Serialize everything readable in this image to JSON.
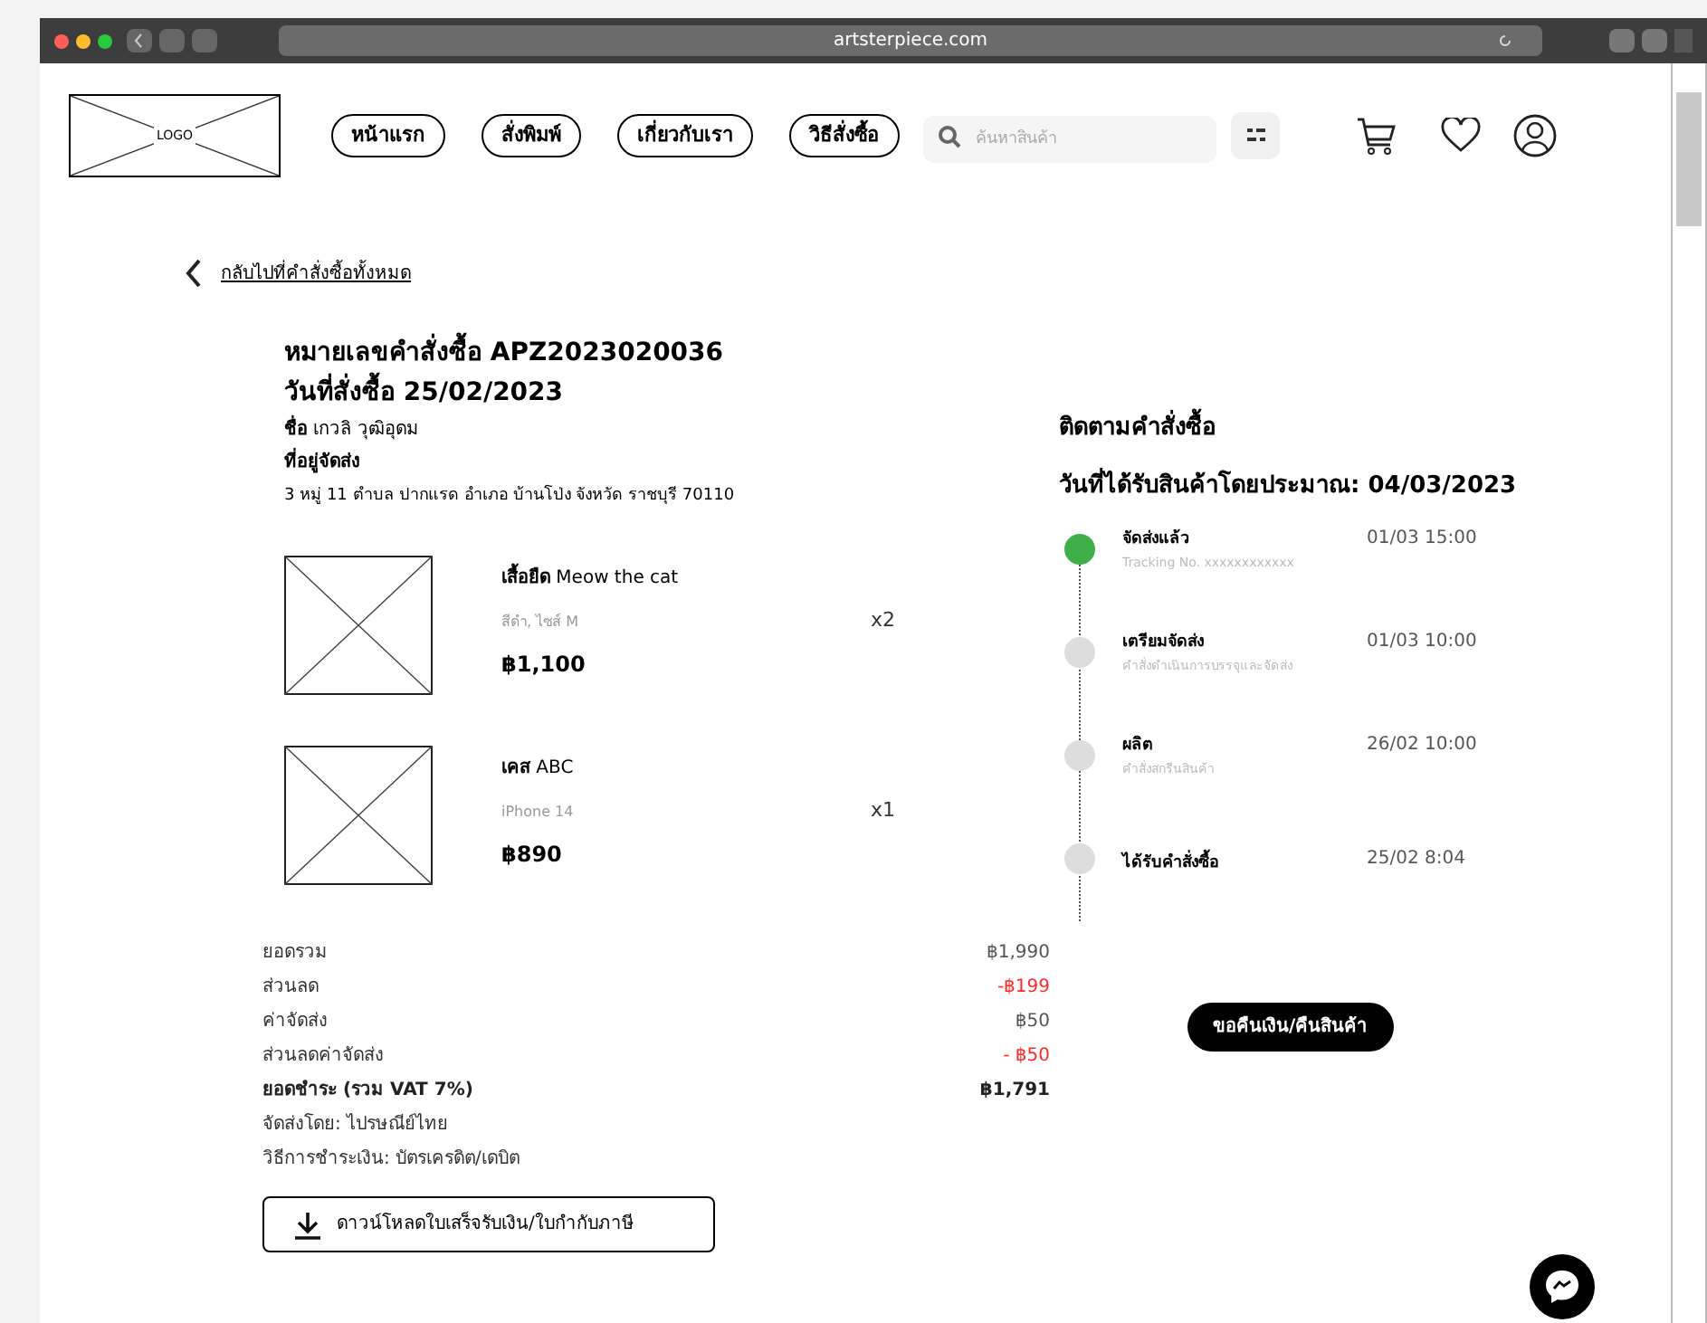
{
  "browser": {
    "url": "artsterpiece.com"
  },
  "nav": {
    "logo": "LOGO",
    "links": [
      "หน้าแรก",
      "สั่งพิมพ์",
      "เกี่ยวกับเรา",
      "วิธีสั่งซื้อ"
    ],
    "search": {
      "placeholder": "ค้นหาสินค้า"
    }
  },
  "back_link": "กลับไปที่คำสั่งซื้อทั้งหมด",
  "order": {
    "number": "หมายเลขคำสั่งซื้อ APZ2023020036",
    "date": "วันที่สั่งซื้อ 25/02/2023",
    "name": "**ชื่อ** เกวลิ วุฒิอุดม",
    "address_label": "ที่อยู่จัดส่ง",
    "address": "3 หมู่ 11 ตำบล ปากแรด อำเภอ บ้านโป่ง จังหวัด ราชบุรี 70110"
  },
  "items": [
    {
      "name": "**เสื้อยืด** Meow the cat",
      "variant": "สีดำ, ไซส์ M",
      "price": "฿1,100",
      "quantity": "x2"
    },
    {
      "name": "**เคส** ABC",
      "variant": "iPhone 14",
      "price": "฿890",
      "quantity": "x1"
    }
  ],
  "summary": [
    {
      "label": "ยอดรวม",
      "value": "฿1,990",
      "kind": "normal"
    },
    {
      "label": "ส่วนลด",
      "value": "-฿199",
      "kind": "discount"
    },
    {
      "label": "ค่าจัดส่ง",
      "value": "฿50",
      "kind": "normal"
    },
    {
      "label": "ส่วนลดค่าจัดส่ง",
      "value": "- ฿50",
      "kind": "discount"
    },
    {
      "label": "ยอดชำระ (รวม VAT 7%)",
      "value": "฿1,791",
      "kind": "total"
    }
  ],
  "shipping_by": "จัดส่งโดย: ไปรษณีย์ไทย",
  "payment_method": "วิธีการชำระเงิน: บัตรเครดิต/เดบิต",
  "download_button": "ดาวน์โหลดใบเสร็จรับเงิน/ใบกำกับภาษี",
  "tracking": {
    "title": "ติดตามคำสั่งซื้อ",
    "eta": "วันที่ได้รับสินค้าโดยประมาณ: 04/03/2023",
    "steps": [
      {
        "title": "จัดส่งแล้ว",
        "detail": "Tracking No. xxxxxxxxxxxx",
        "time": "01/03 15:00",
        "done": true
      },
      {
        "title": "เตรียมจัดส่ง",
        "detail": "คำสั่งดำเนินการบรรจุและจัดส่ง",
        "time": "01/03 10:00",
        "done": false
      },
      {
        "title": "ผลิต",
        "detail": "คำสั่งสกรีนสินค้า",
        "time": "26/02 10:00",
        "done": false
      },
      {
        "title": "ได้รับคำสั่งซื้อ",
        "time": "25/02 8:04",
        "done": false
      }
    ]
  },
  "refund_button": "ขอคืนเงิน/คืนสินค้า"
}
